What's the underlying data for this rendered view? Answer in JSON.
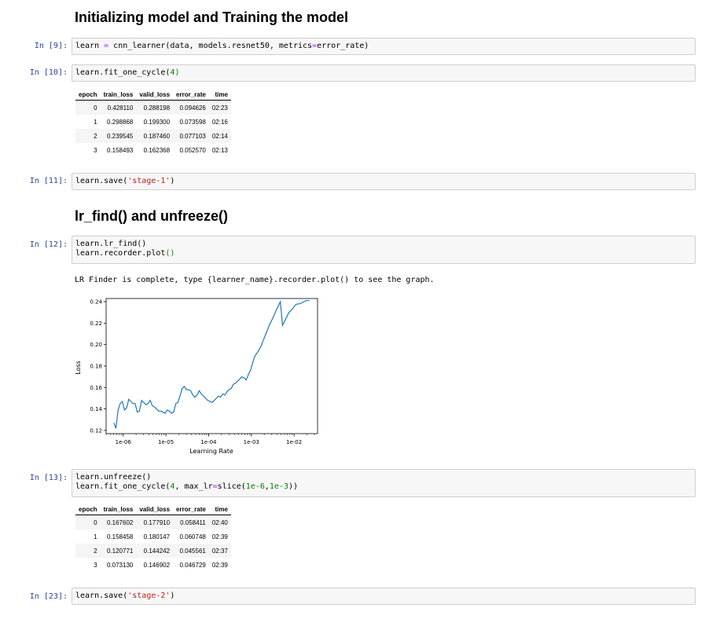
{
  "headings": {
    "h1": "Initializing model and Training the model",
    "h2": "lr_find() and unfreeze()"
  },
  "cells": {
    "c9": {
      "prompt": "In [9]:",
      "code": {
        "a": "learn ",
        "op": "=",
        "b": " cnn_learner(data, models.resnet50, metrics",
        "op2": "=",
        "c": "error_rate)"
      }
    },
    "c10": {
      "prompt": "In [10]:",
      "code": {
        "a": "learn.fit_one_cycle(",
        "num": "4",
        "b": ")"
      }
    },
    "c11": {
      "prompt": "In [11]:",
      "code": {
        "a": "learn.save(",
        "str": "'stage-1'",
        "b": ")"
      }
    },
    "c12": {
      "prompt": "In [12]:",
      "line1": "learn.lr_find()",
      "line2a": "learn.recorder.plot",
      "line2b": "()",
      "output": "LR Finder is complete, type {learner_name}.recorder.plot() to see the graph."
    },
    "c13": {
      "prompt": "In [13]:",
      "line1": "learn.unfreeze()",
      "line2": {
        "a": "learn.fit_one_cycle(",
        "n1": "4",
        "b": ", max_lr",
        "op": "=",
        "c": "slice(",
        "n2": "1e-6",
        "d": ",",
        "n3": "1e-3",
        "e": "))"
      }
    },
    "c23": {
      "prompt": "In [23]:",
      "code": {
        "a": "learn.save(",
        "str": "'stage-2'",
        "b": ")"
      }
    }
  },
  "table1": {
    "headers": [
      "epoch",
      "train_loss",
      "valid_loss",
      "error_rate",
      "time"
    ],
    "rows": [
      [
        "0",
        "0.428110",
        "0.288198",
        "0.094626",
        "02:23"
      ],
      [
        "1",
        "0.298868",
        "0.199300",
        "0.073598",
        "02:16"
      ],
      [
        "2",
        "0.239545",
        "0.187460",
        "0.077103",
        "02:14"
      ],
      [
        "3",
        "0.158493",
        "0.162368",
        "0.052570",
        "02:13"
      ]
    ]
  },
  "table2": {
    "headers": [
      "epoch",
      "train_loss",
      "valid_loss",
      "error_rate",
      "time"
    ],
    "rows": [
      [
        "0",
        "0.167602",
        "0.177910",
        "0.058411",
        "02:40"
      ],
      [
        "1",
        "0.158458",
        "0.180147",
        "0.060748",
        "02:39"
      ],
      [
        "2",
        "0.120771",
        "0.144242",
        "0.045561",
        "02:37"
      ],
      [
        "3",
        "0.073130",
        "0.146902",
        "0.046729",
        "02:39"
      ]
    ]
  },
  "chart_data": {
    "type": "line",
    "xlabel": "Learning Rate",
    "ylabel": "Loss",
    "xscale": "log",
    "xticks": [
      "1e-06",
      "1e-05",
      "1e-04",
      "1e-03",
      "1e-02"
    ],
    "yticks": [
      "0.12",
      "0.14",
      "0.16",
      "0.18",
      "0.20",
      "0.22",
      "0.24"
    ],
    "ylim": [
      0.117,
      0.243
    ],
    "xlim_log10": [
      -6.4,
      -1.45
    ],
    "grid": false,
    "line_color": "#1f77b4",
    "series": [
      {
        "log10_x": [
          -6.22,
          -6.17,
          -6.12,
          -6.07,
          -6.02,
          -5.97,
          -5.92,
          -5.87,
          -5.82,
          -5.77,
          -5.72,
          -5.67,
          -5.62,
          -5.57,
          -5.52,
          -5.47,
          -5.42,
          -5.37,
          -5.32,
          -5.27,
          -5.22,
          -5.17,
          -5.12,
          -5.07,
          -5.02,
          -4.97,
          -4.92,
          -4.87,
          -4.82,
          -4.77,
          -4.72,
          -4.67,
          -4.62,
          -4.57,
          -4.52,
          -4.47,
          -4.42,
          -4.37,
          -4.32,
          -4.27,
          -4.22,
          -4.17,
          -4.12,
          -4.07,
          -4.02,
          -3.97,
          -3.92,
          -3.87,
          -3.82,
          -3.77,
          -3.72,
          -3.67,
          -3.62,
          -3.57,
          -3.52,
          -3.47,
          -3.42,
          -3.37,
          -3.32,
          -3.27,
          -3.22,
          -3.17,
          -3.12,
          -3.07,
          -3.02,
          -2.97,
          -2.92,
          -2.87,
          -2.82,
          -2.77,
          -2.72,
          -2.67,
          -2.62,
          -2.57,
          -2.52,
          -2.47,
          -2.42,
          -2.37,
          -2.32,
          -2.27,
          -2.22,
          -2.17,
          -2.12,
          -2.07,
          -2.02,
          -1.97,
          -1.92,
          -1.87,
          -1.82,
          -1.77,
          -1.72,
          -1.67,
          -1.64
        ],
        "y": [
          0.127,
          0.122,
          0.139,
          0.145,
          0.147,
          0.139,
          0.141,
          0.149,
          0.147,
          0.145,
          0.145,
          0.137,
          0.138,
          0.148,
          0.146,
          0.144,
          0.145,
          0.148,
          0.143,
          0.142,
          0.14,
          0.138,
          0.138,
          0.137,
          0.136,
          0.139,
          0.138,
          0.136,
          0.137,
          0.145,
          0.146,
          0.152,
          0.159,
          0.161,
          0.158,
          0.158,
          0.157,
          0.153,
          0.151,
          0.153,
          0.157,
          0.154,
          0.152,
          0.15,
          0.148,
          0.147,
          0.146,
          0.148,
          0.15,
          0.152,
          0.151,
          0.154,
          0.153,
          0.156,
          0.158,
          0.159,
          0.163,
          0.164,
          0.166,
          0.168,
          0.17,
          0.169,
          0.167,
          0.172,
          0.176,
          0.183,
          0.189,
          0.192,
          0.195,
          0.199,
          0.204,
          0.209,
          0.214,
          0.219,
          0.223,
          0.227,
          0.232,
          0.236,
          0.24,
          0.218,
          0.222,
          0.226,
          0.23,
          0.232,
          0.234,
          0.237,
          0.238,
          0.238,
          0.239,
          0.24,
          0.241,
          0.241,
          0.241
        ]
      }
    ]
  }
}
